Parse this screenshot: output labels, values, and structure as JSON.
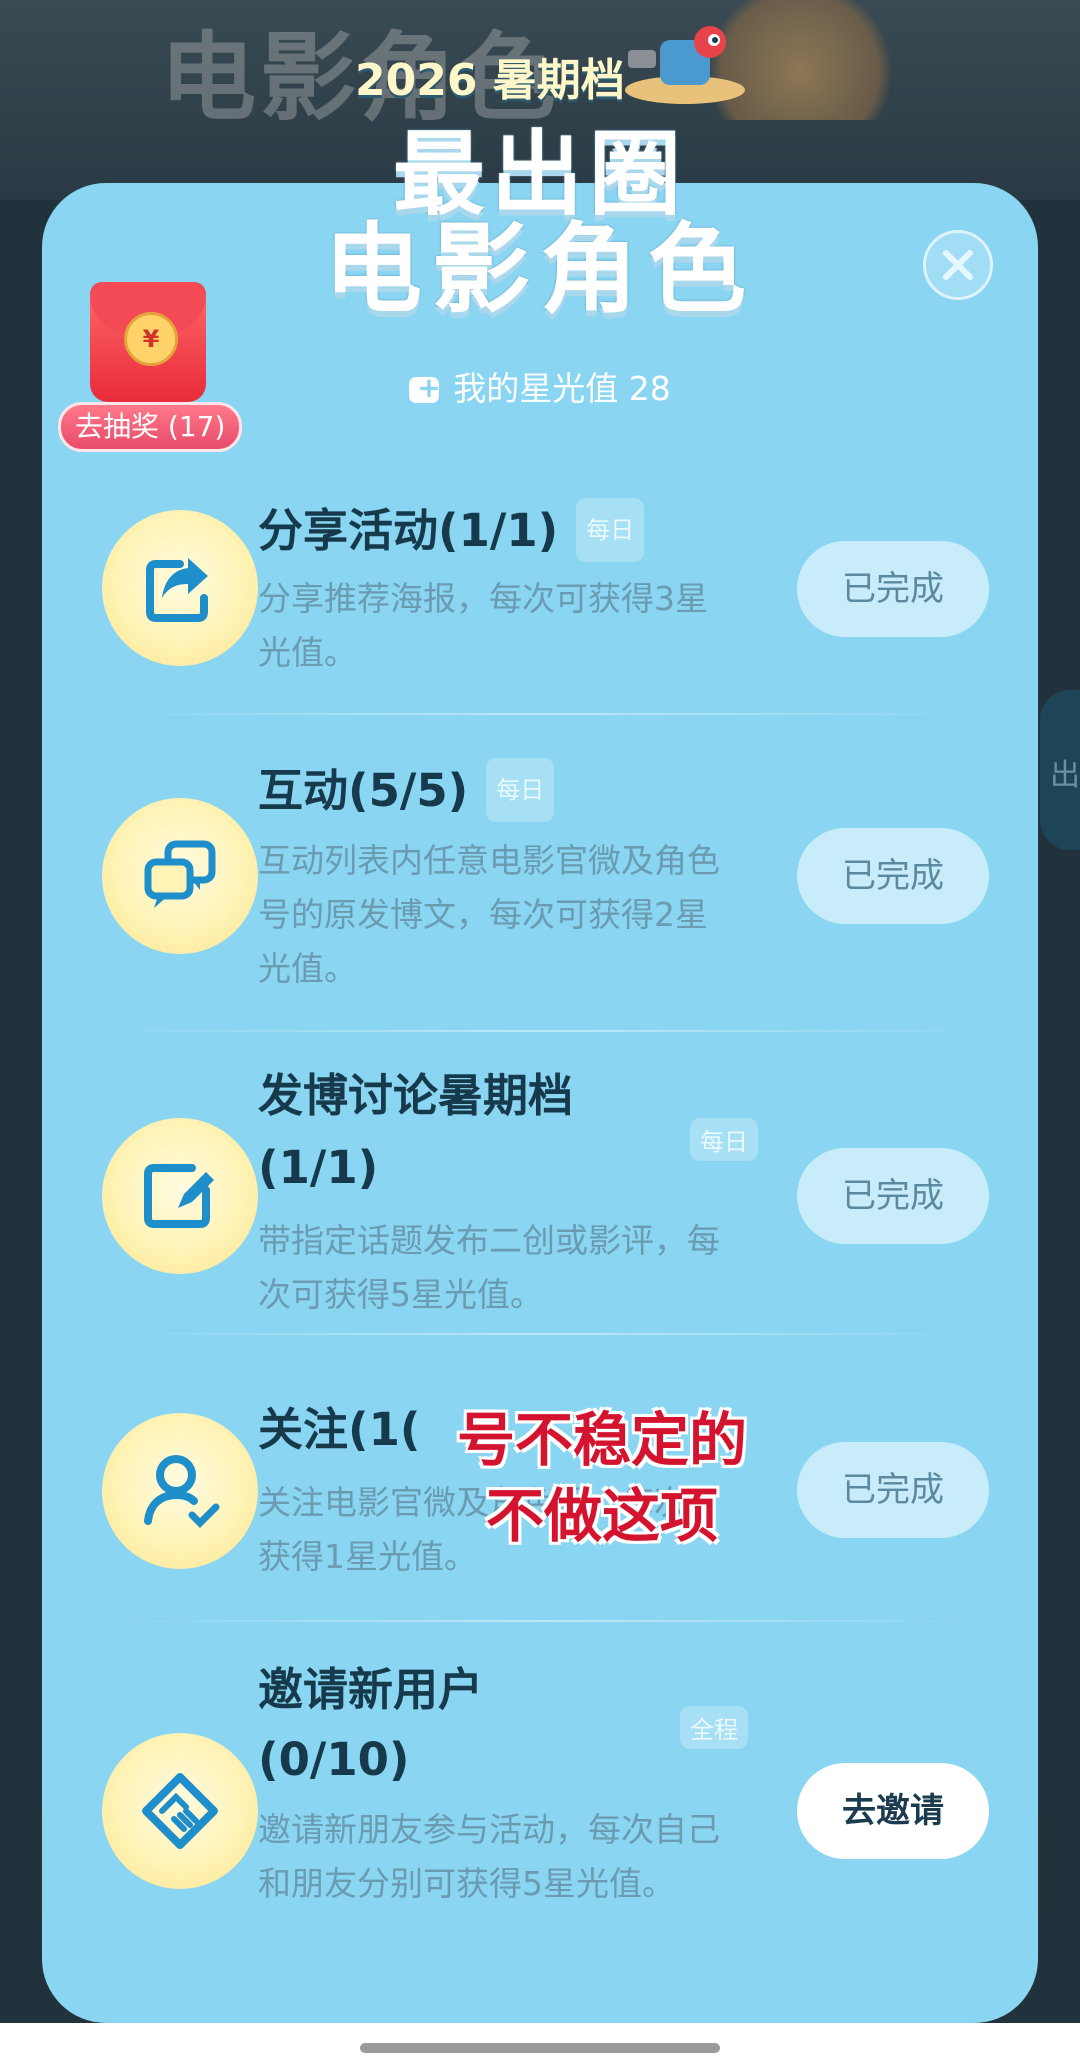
{
  "header": {
    "year_label": "2026 暑期档",
    "title_line1": "最出圈",
    "title_line2": "电影角色",
    "bg_faded_text": "电影角色"
  },
  "lottery": {
    "label": "去抽奖 (17)",
    "coin_symbol": "¥"
  },
  "star_value": {
    "label": "我的星光值 28"
  },
  "tasks": [
    {
      "title": "分享活动(1/1)",
      "tag": "每日",
      "desc": "分享推荐海报，每次可获得3星光值。",
      "button": "已完成",
      "icon": "share-icon"
    },
    {
      "title": "互动(5/5)",
      "tag": "每日",
      "desc": "互动列表内任意电影官微及角色号的原发博文，每次可获得2星光值。",
      "button": "已完成",
      "icon": "chat-icon"
    },
    {
      "title_line1": "发博讨论暑期档",
      "title_line2": "(1/1)",
      "tag": "每日",
      "desc": "带指定话题发布二创或影评，每次可获得5星光值。",
      "button": "已完成",
      "icon": "edit-icon"
    },
    {
      "title": "关注(1(",
      "desc": "关注电影官微及角色号，每次可获得1星光值。",
      "button": "已完成",
      "icon": "follow-user-icon"
    },
    {
      "title_line1": "邀请新用户",
      "title_line2": "(0/10)",
      "tag": "全程",
      "desc": "邀请新朋友参与活动，每次自己和朋友分别可获得5星光值。",
      "button": "去邀请",
      "icon": "handshake-icon"
    }
  ],
  "overlay_note": {
    "line1": "号不稳定的",
    "line2": "不做这项"
  },
  "colors": {
    "modal_bg": "#8ad5f2",
    "title_text": "#163a4c",
    "desc_text": "#6a9bb0",
    "done_button_bg": "#c9ecfb",
    "invite_button_bg": "#ffffff",
    "overlay_red": "#d4142f"
  }
}
